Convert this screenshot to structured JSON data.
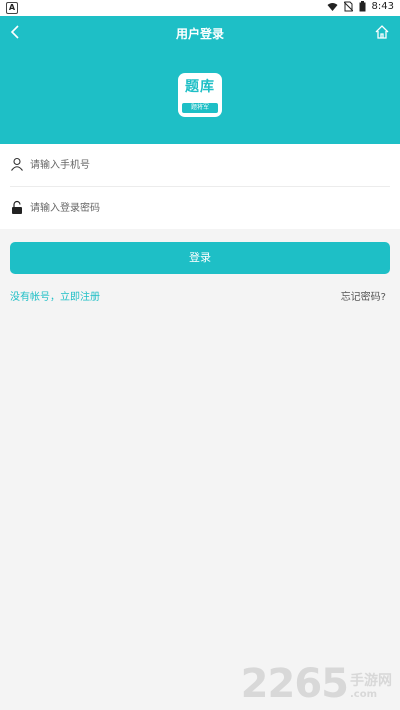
{
  "status_bar": {
    "time": "8:43",
    "left_badge": "A"
  },
  "header": {
    "title": "用户登录",
    "logo": {
      "main": "题库",
      "sub": "题将军"
    }
  },
  "form": {
    "phone_placeholder": "请输入手机号",
    "password_placeholder": "请输入登录密码"
  },
  "actions": {
    "login_label": "登录",
    "register_link": "没有帐号，立即注册",
    "forgot_link": "忘记密码?"
  },
  "watermark": {
    "number": "2265",
    "cn": "手游网",
    "domain": ".com"
  },
  "colors": {
    "accent": "#1ebfc6",
    "background": "#f4f4f4"
  }
}
